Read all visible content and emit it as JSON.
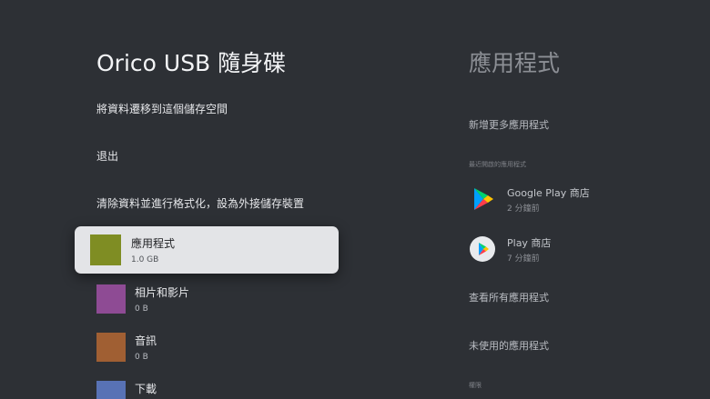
{
  "storage_panel": {
    "title": "Orico USB 隨身碟",
    "actions": {
      "migrate": "將資料遷移到這個儲存空間",
      "eject": "退出",
      "format": "清除資料並進行格式化，設為外接儲存裝置"
    },
    "items": [
      {
        "name": "應用程式",
        "size": "1.0 GB",
        "color": "#7f8d23",
        "focused": true
      },
      {
        "name": "相片和影片",
        "size": "0 B",
        "color": "#8e4b94"
      },
      {
        "name": "音訊",
        "size": "0 B",
        "color": "#a05f33"
      },
      {
        "name": "下載",
        "size": "",
        "color": "#5872b5"
      }
    ]
  },
  "preview_panel": {
    "title": "應用程式",
    "add_more": "新增更多應用程式",
    "recent_label": "最近開啟的應用程式",
    "recent_apps": [
      {
        "name": "Google Play 商店",
        "time": "2 分鐘前",
        "icon": "google-play-store-icon"
      },
      {
        "name": "Play 商店",
        "time": "7 分鐘前",
        "icon": "play-games-icon"
      }
    ],
    "see_all": "查看所有應用程式",
    "unused": "未使用的應用程式",
    "permissions_label": "權限"
  },
  "colors": {
    "background": "#2d3035",
    "focus_card": "#e3e4e7"
  }
}
